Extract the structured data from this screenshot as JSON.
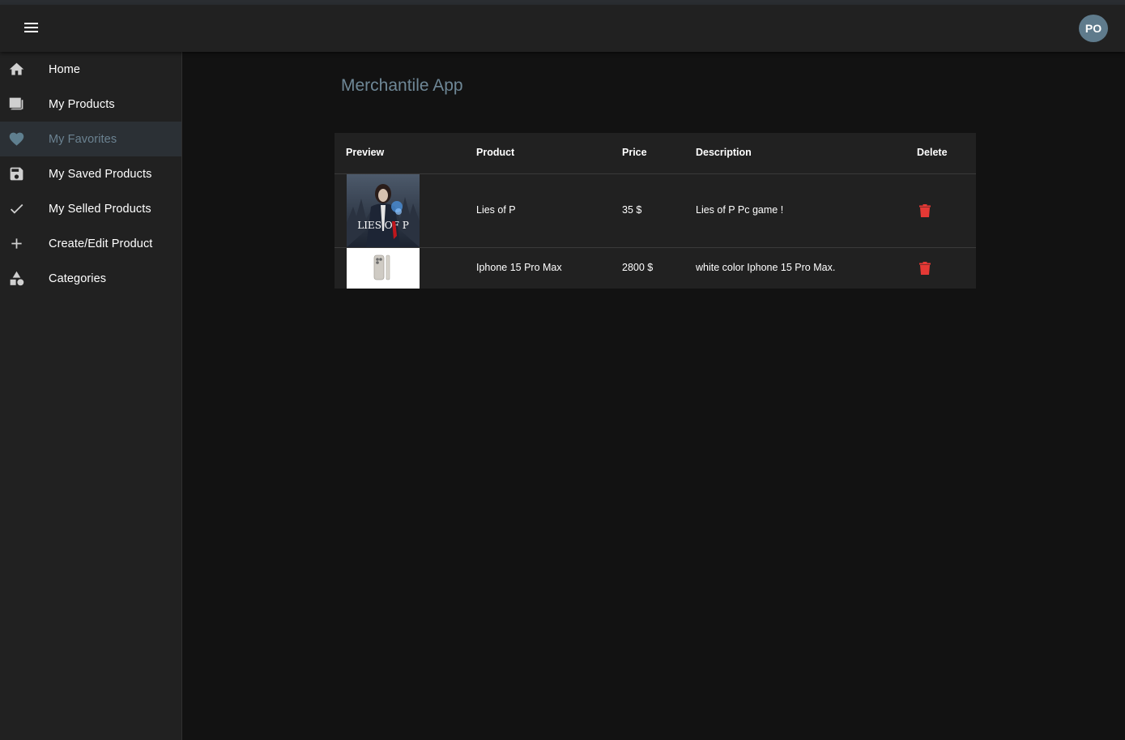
{
  "app": {
    "title": "Merchantile App",
    "avatar_initials": "PO"
  },
  "sidebar": {
    "items": [
      {
        "label": "Home",
        "icon": "home-icon"
      },
      {
        "label": "My Products",
        "icon": "products-icon"
      },
      {
        "label": "My Favorites",
        "icon": "heart-icon",
        "active": true
      },
      {
        "label": "My Saved Products",
        "icon": "save-icon"
      },
      {
        "label": "My Selled Products",
        "icon": "check-icon"
      },
      {
        "label": "Create/Edit Product",
        "icon": "plus-icon"
      },
      {
        "label": "Categories",
        "icon": "categories-icon"
      }
    ]
  },
  "table": {
    "headers": {
      "preview": "Preview",
      "product": "Product",
      "price": "Price",
      "description": "Description",
      "delete": "Delete"
    },
    "rows": [
      {
        "product": "Lies of P",
        "price": "35 $",
        "description": "Lies of P Pc game !",
        "preview_icon": "game-cover-image",
        "preview_text": "LIES OF P"
      },
      {
        "product": "Iphone 15 Pro Max",
        "price": "2800 $",
        "description": "white color Iphone 15 Pro Max.",
        "preview_icon": "phone-image"
      }
    ]
  },
  "colors": {
    "accent": "#6e8796",
    "delete": "#e53935",
    "background": "#121212",
    "surface": "#212121"
  }
}
